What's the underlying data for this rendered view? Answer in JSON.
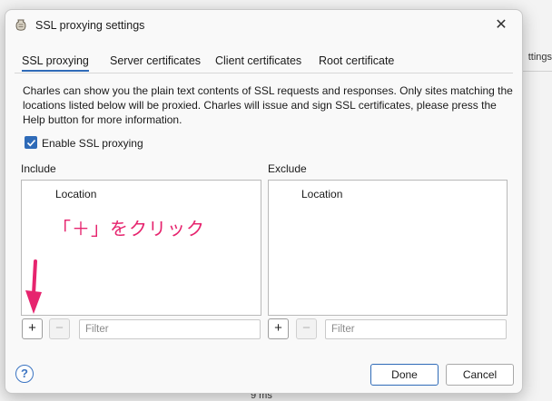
{
  "background": {
    "settings_fragment": "ttings",
    "status_text": "9 ms"
  },
  "dialog": {
    "title": "SSL proxying settings",
    "close_glyph": "✕",
    "app_icon": "charles-jug-icon"
  },
  "tabs": [
    {
      "label": "SSL proxying",
      "active": true
    },
    {
      "label": "Server certificates",
      "active": false
    },
    {
      "label": "Client certificates",
      "active": false
    },
    {
      "label": "Root certificate",
      "active": false
    }
  ],
  "description": "Charles can show you the plain text contents of SSL requests and responses. Only sites matching the locations listed below will be proxied. Charles will issue and sign SSL certificates, please press the Help button for more information.",
  "enable_ssl": {
    "label": "Enable SSL proxying",
    "checked": true
  },
  "include": {
    "label": "Include",
    "column_header": "Location",
    "add_glyph": "+",
    "remove_glyph": "−",
    "filter_placeholder": "Filter"
  },
  "exclude": {
    "label": "Exclude",
    "column_header": "Location",
    "add_glyph": "+",
    "remove_glyph": "−",
    "filter_placeholder": "Filter"
  },
  "annotation": {
    "text": "「＋」をクリック",
    "color": "#e6246e"
  },
  "footer": {
    "help_glyph": "?",
    "done_label": "Done",
    "cancel_label": "Cancel"
  },
  "colors": {
    "accent": "#2f6bb8"
  }
}
